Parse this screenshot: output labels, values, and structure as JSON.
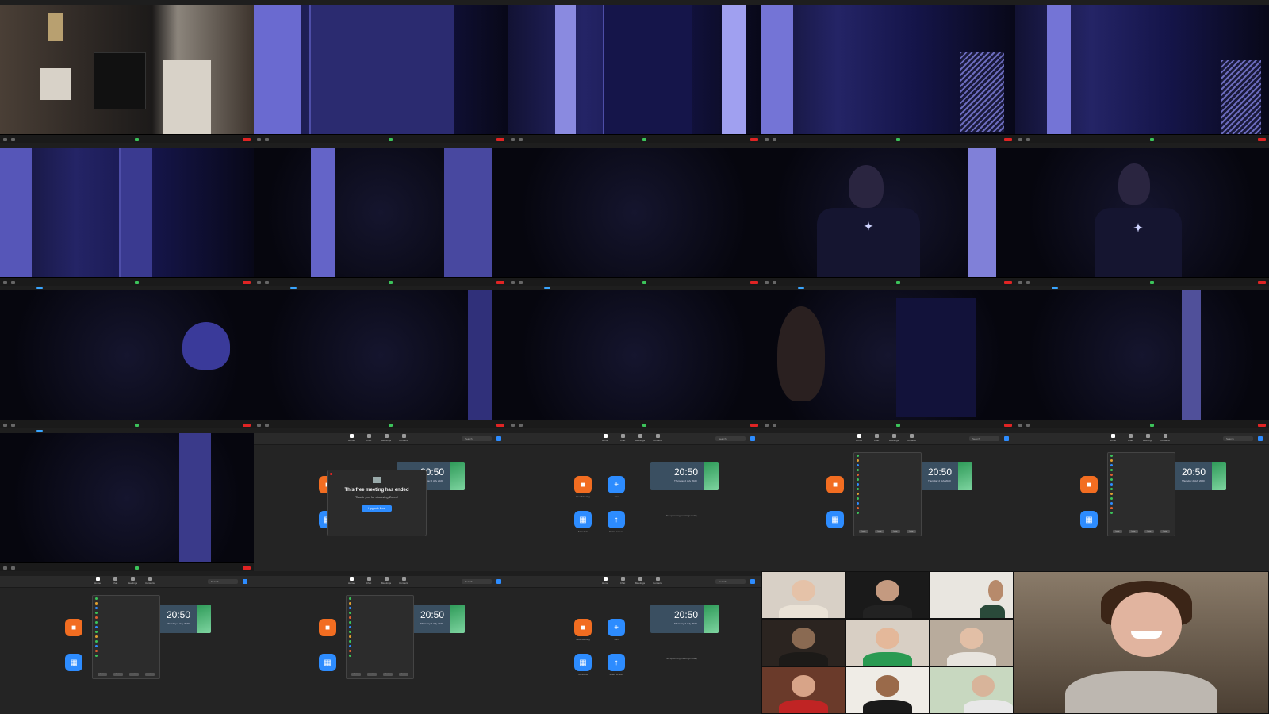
{
  "home_panel": {
    "search_label": "Search",
    "tabs": [
      "Home",
      "Chat",
      "Meetings",
      "Contacts"
    ],
    "buttons": {
      "new_meeting": "New Meeting",
      "join": "Join",
      "schedule": "Schedule",
      "share_screen": "Share screen"
    },
    "clock": {
      "time": "20:50",
      "date": "Thursday 2 July 2020"
    },
    "upcoming": "No upcoming meetings today"
  },
  "ended_dialog": {
    "title": "This free meeting has ended",
    "subtitle": "Thank you for choosing Zoom!",
    "button": "Upgrade Now"
  },
  "contact_buttons": [
    "Invite",
    "Invite",
    "Invite",
    "Invite"
  ],
  "colors": {
    "zoom_blue": "#2d8cff",
    "zoom_orange": "#f26d21",
    "end_red": "#e02424",
    "active_green": "#3cc35a"
  }
}
